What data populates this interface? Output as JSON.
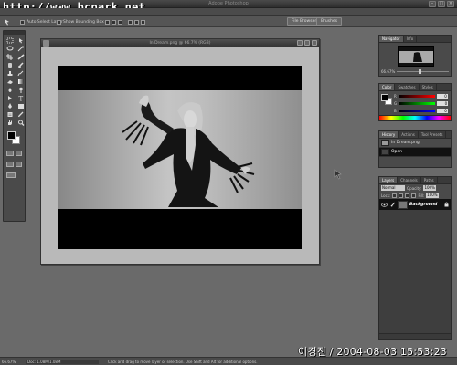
{
  "watermark": "http://www.bcpark.net",
  "app_title": "Adobe Photoshop",
  "options_bar": {
    "auto_select_layer": "Auto Select Layer",
    "show_bounding_box": "Show Bounding Box",
    "file_browser_tab": "File Browser",
    "brushes_tab": "Brushes"
  },
  "document": {
    "title": "In Dream.png @ 66.7% (RGB)"
  },
  "navigator": {
    "tabs": [
      "Navigator",
      "Info"
    ],
    "zoom": "66.67%"
  },
  "color_panel": {
    "tabs": [
      "Color",
      "Swatches",
      "Styles"
    ],
    "channels": [
      {
        "label": "R",
        "value": "0"
      },
      {
        "label": "G",
        "value": "0"
      },
      {
        "label": "B",
        "value": "0"
      }
    ]
  },
  "history_panel": {
    "tabs": [
      "History",
      "Actions",
      "Tool Presets"
    ],
    "items": [
      {
        "label": "In Dream.png",
        "selected": false
      },
      {
        "label": "Open",
        "selected": true
      }
    ]
  },
  "layers_panel": {
    "tabs": [
      "Layers",
      "Channels",
      "Paths"
    ],
    "blend_mode": "Normal",
    "opacity_label": "Opacity:",
    "opacity": "100%",
    "lock_label": "Lock:",
    "fill_label": "Fill:",
    "fill": "100%",
    "layers": [
      {
        "name": "Background"
      }
    ]
  },
  "status_bar": {
    "zoom": "66.67%",
    "doc_size": "Doc: 1.08M/1.08M",
    "hint": "Click and drag to move layer or selection. Use Shift and Alt for additional options."
  },
  "date_watermark": "이경진 / 2004-08-03 15:53:23",
  "colors": {
    "workspace": "#6a6a6a",
    "panel": "#4a4a4a",
    "selection_row": "#111111",
    "nav_box": "#ee0000"
  }
}
